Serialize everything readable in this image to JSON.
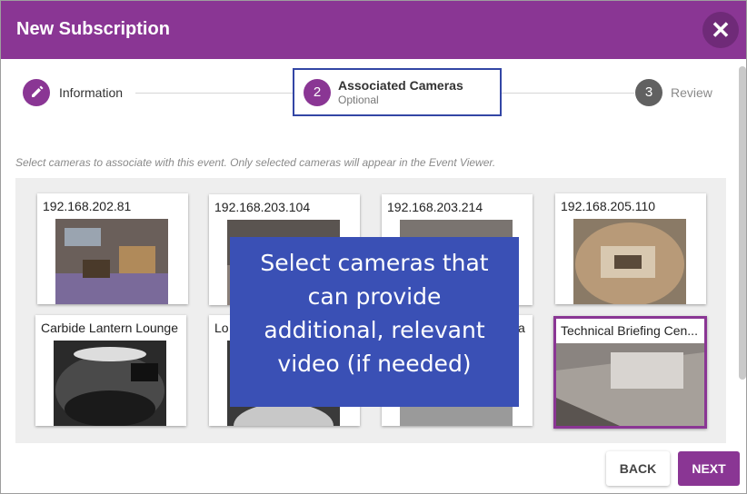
{
  "dialog": {
    "title": "New Subscription",
    "close_icon": "close-icon",
    "accent": "#8a3694"
  },
  "stepper": {
    "steps": [
      {
        "number": "",
        "icon": "pencil-icon",
        "label": "Information",
        "sublabel": ""
      },
      {
        "number": "2",
        "label": "Associated Cameras",
        "sublabel": "Optional"
      },
      {
        "number": "3",
        "label": "Review",
        "sublabel": ""
      }
    ]
  },
  "instructions": "Select cameras to associate with this event. Only selected cameras will appear in the Event Viewer.",
  "cameras": [
    {
      "label": "192.168.202.81",
      "selected": false
    },
    {
      "label": "192.168.203.104",
      "selected": false
    },
    {
      "label": "192.168.203.214",
      "selected": false
    },
    {
      "label": "192.168.205.110",
      "selected": false
    },
    {
      "label": "Carbide Lantern Lounge",
      "selected": false
    },
    {
      "label": "Lo",
      "selected": false
    },
    {
      "label": "a",
      "selected": false
    },
    {
      "label": "Technical Briefing Cen...",
      "selected": true
    }
  ],
  "tooltip": {
    "lines": [
      "Select cameras that",
      "can provide",
      "additional, relevant",
      "video (if needed)"
    ]
  },
  "footer": {
    "back_label": "BACK",
    "next_label": "NEXT"
  }
}
